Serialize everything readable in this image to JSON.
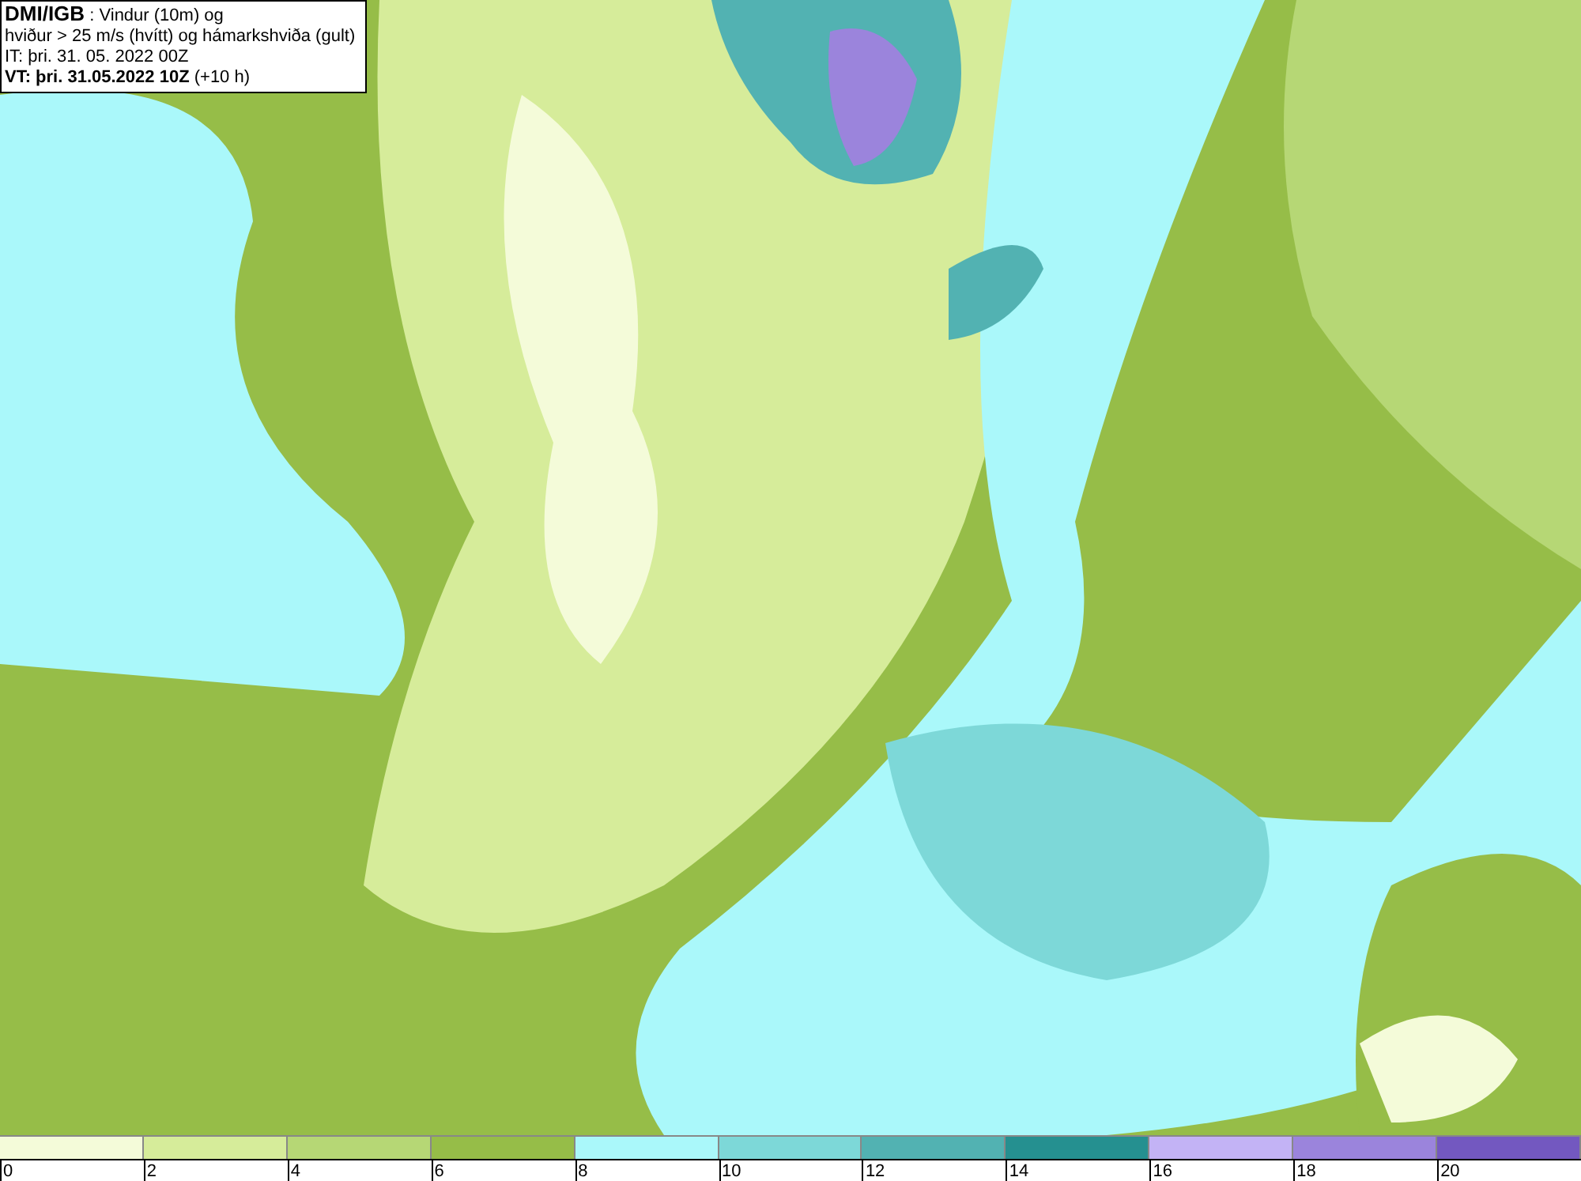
{
  "header": {
    "lines": [
      "**DMI/IGB** : Vindur (10m) og",
      "hviður > 25 m/s (hvítt) og hámarkshviða (gult)",
      "IT: þri. 31. 05. 2022 00Z",
      "**VT: þri. 31.05.2022 10Z** (+10 h)"
    ]
  },
  "legend": {
    "segments": [
      {
        "color": "#f4fbd9",
        "label": "0"
      },
      {
        "color": "#d6ec9a",
        "label": "2"
      },
      {
        "color": "#b6d775",
        "label": "4"
      },
      {
        "color": "#96bd48",
        "label": "6"
      },
      {
        "color": "#aaf8fa",
        "label": "8"
      },
      {
        "color": "#7dd8d8",
        "label": "10"
      },
      {
        "color": "#52b2b2",
        "label": "12"
      },
      {
        "color": "#259090",
        "label": "14"
      },
      {
        "color": "#c3b3f5",
        "label": "16"
      },
      {
        "color": "#9b84dc",
        "label": "18"
      },
      {
        "color": "#7358c0",
        "label": "20"
      }
    ]
  }
}
